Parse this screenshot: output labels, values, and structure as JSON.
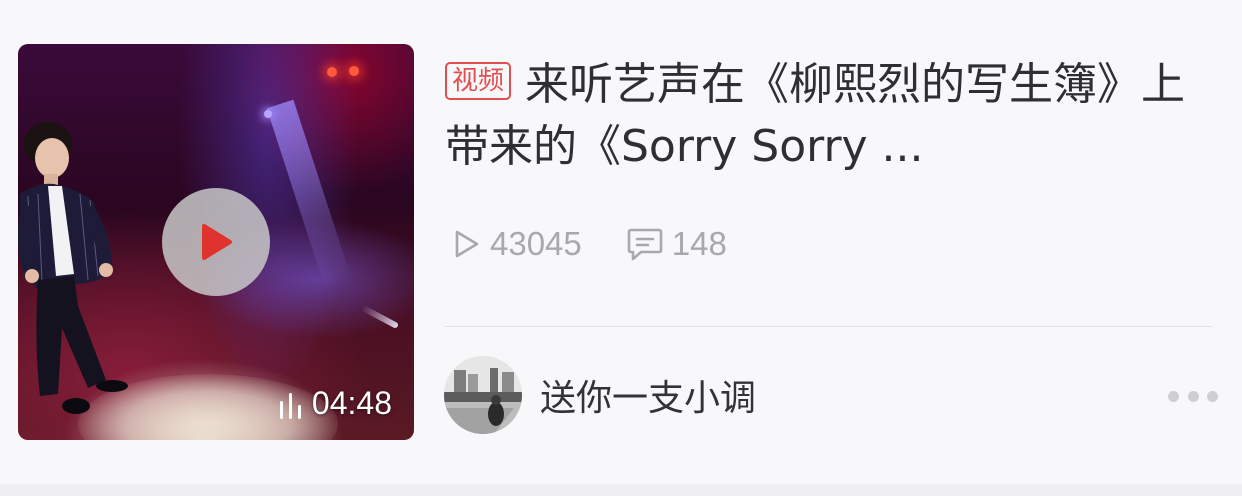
{
  "video": {
    "tag": "视频",
    "title": "来听艺声在《柳熙烈的写生簿》上带来的《Sorry Sorry ...",
    "duration": "04:48",
    "play_count": "43045",
    "comment_count": "148"
  },
  "author": {
    "name": "送你一支小调"
  },
  "icons": {
    "play": "play-icon",
    "views": "play-outline-icon",
    "comments": "comment-bubble-icon",
    "audio": "sound-bars-icon",
    "more": "more-dots-icon"
  },
  "colors": {
    "tag": "#e05050",
    "play_triangle": "#e0332d",
    "stats": "#a8a8ae",
    "title": "#2f2f33"
  }
}
